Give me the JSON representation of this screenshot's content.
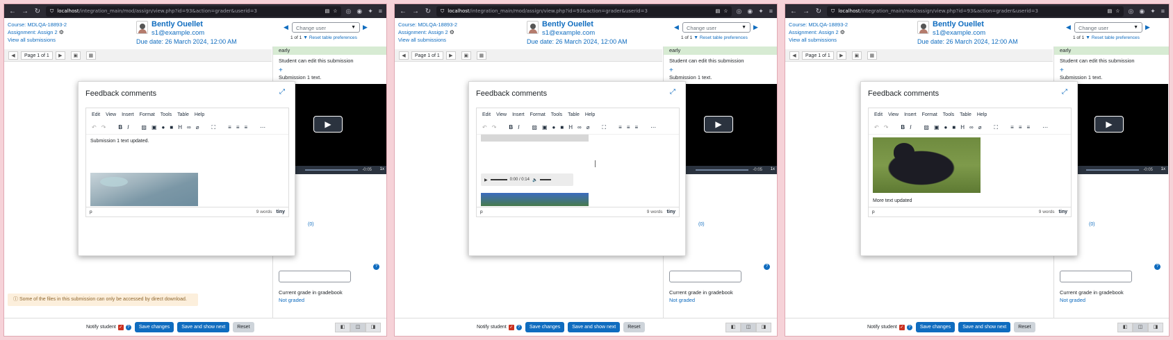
{
  "browser": {
    "url_host": "localhost",
    "url_path": "/integration_main/mod/assign/view.php?id=93&action=grader&userid=3"
  },
  "header": {
    "course": "Course: MDLQA-18893-2",
    "assignment": "Assignment: Assign 2",
    "view_all": "View all submissions",
    "user_name": "Bently Ouellet",
    "user_email": "s1@example.com",
    "due_date": "Due date: 26 March 2024, 12:00 AM",
    "change_user_placeholder": "Change user",
    "pager": "1 of 1",
    "reset_prefs": "Reset table preferences"
  },
  "pager_bar": {
    "page_label": "Page 1 of 1"
  },
  "right_panel": {
    "status": "early",
    "can_edit": "Student can edit this submission",
    "submission_text": "Submission 1 text.",
    "video_time": "-0:05",
    "video_rate": "1x",
    "fragment_link": "(0)",
    "fragment_label": "0",
    "current_grade_label": "Current grade in gradebook",
    "not_graded": "Not graded"
  },
  "warning_text": "Some of the files in this submission can only be accessed by direct download.",
  "footer": {
    "notify_label": "Notify student",
    "save_changes": "Save changes",
    "save_next": "Save and show next",
    "reset": "Reset"
  },
  "modal": {
    "title": "Feedback comments",
    "menu": [
      "Edit",
      "View",
      "Insert",
      "Format",
      "Tools",
      "Table",
      "Help"
    ],
    "path": "p",
    "word_count": "9 words",
    "tiny": "tiny"
  },
  "panels": [
    {
      "content_text": "Submission 1 text updated."
    },
    {
      "audio_time": "0:00 / 0:14"
    },
    {
      "content_text": "More text updated"
    }
  ]
}
